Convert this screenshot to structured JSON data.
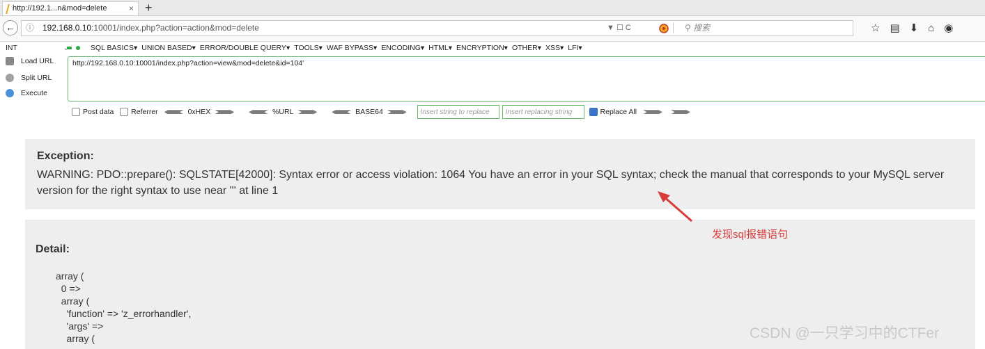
{
  "browser": {
    "tab_title": "http://192.1...n&mod=delete",
    "tab_close": "×",
    "new_tab": "+",
    "back": "←",
    "info": "ⓘ",
    "url_host": "192.168.0.10",
    "url_rest": ":10001/index.php?action=action&mod=delete",
    "url_tools": "▼ ☐  C",
    "search_placeholder": "搜索"
  },
  "hackbar": {
    "int_label": "INT",
    "menus": [
      "SQL BASICS▾",
      "UNION BASED▾",
      "ERROR/DOUBLE QUERY▾",
      "TOOLS▾",
      "WAF BYPASS▾",
      "ENCODING▾",
      "HTML▾",
      "ENCRYPTION▾",
      "OTHER▾",
      "XSS▾",
      "LFI▾"
    ],
    "load_url": "Load URL",
    "split_url": "Split URL",
    "execute": "Execute",
    "url_value": "http://192.168.0.10:10001/index.php?action=view&mod=delete&id=104'",
    "post_data": "Post data",
    "referrer": "Referrer",
    "hex": "0xHEX",
    "urlenc": "%URL",
    "base64": "BASE64",
    "replace_placeholder": "Insert string to replace",
    "replacing_placeholder": "Insert replacing string",
    "replace_all": "Replace All"
  },
  "exception": {
    "title": "Exception:",
    "message": "WARNING: PDO::prepare(): SQLSTATE[42000]: Syntax error or access violation: 1064 You have an error in your SQL syntax; check the manual that corresponds to your MySQL server version for the right syntax to use near ''' at line 1"
  },
  "detail": {
    "title": "Detail:",
    "code": "array (\n  0 =>\n  array (\n    'function' => 'z_errorhandler',\n    'args' =>\n    array ("
  },
  "annotation": "发现sql报错语句",
  "watermark": "CSDN @一只学习中的CTFer",
  "colors": {
    "accent_green": "#62b86b",
    "annotation_red": "#d93a3a",
    "panel_bg": "#eeeeee"
  }
}
